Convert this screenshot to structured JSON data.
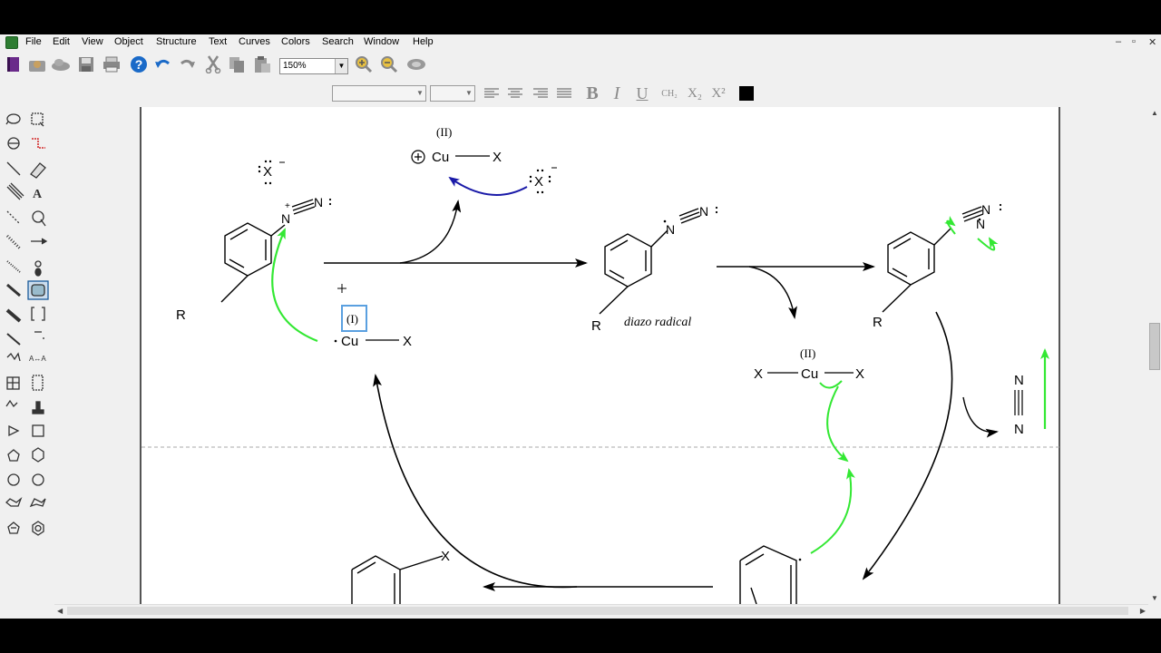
{
  "menu": [
    "File",
    "Edit",
    "View",
    "Object",
    "Structure",
    "Text",
    "Curves",
    "Colors",
    "Search",
    "Window",
    "Help"
  ],
  "window_controls": [
    "–",
    "▫",
    "✕"
  ],
  "toolbar": {
    "zoom": "150%"
  },
  "format_bar": {
    "bold": "B",
    "italic": "I",
    "underline": "U",
    "ch2": "CH₂",
    "subscript": "X₂",
    "superscript": "X²"
  },
  "scheme": {
    "cu2_top_label": "(II)",
    "cu2_top_metal": "Cu",
    "cu2_top_x": "X",
    "halide_top_left": "X",
    "halide_top_right": "X",
    "diazonium_n1": "N",
    "diazonium_n2": "N",
    "r_group": "R",
    "cu1_label": "(I)",
    "cu1_metal": "Cu",
    "cu1_x": "X",
    "radical_n1": "N",
    "radical_n2": "N",
    "radical_r": "R",
    "radical_caption": "diazo radical",
    "right_n1": "N",
    "right_n2": "N",
    "right_r": "R",
    "cu2_mid_label": "(II)",
    "cu2_mid_left_x": "X",
    "cu2_mid_metal": "Cu",
    "cu2_mid_right_x": "X",
    "n2_top": "N",
    "n2_bottom": "N",
    "product_x": "X"
  },
  "colors": {
    "green_arrow": "#33e833",
    "blue_arrow": "#1a1aa8",
    "select_box": "#5aa0e0"
  }
}
